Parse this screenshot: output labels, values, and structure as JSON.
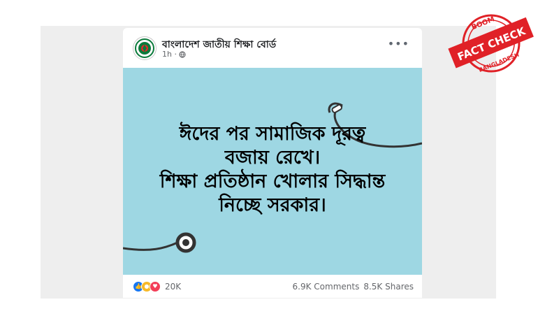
{
  "post": {
    "page_name": "বাংলাদেশ জাতীয় শিক্ষা বোর্ড",
    "time": "1h ·",
    "more_label": "•••",
    "image_text": [
      "ঈদের পর সামাজিক দূরত্ব",
      "বজায় রেখে।",
      "শিক্ষা প্রতিষ্ঠান খোলার সিদ্ধান্ত",
      "নিচ্ছে সরকার।"
    ],
    "reaction_count": "20K",
    "comments": "6.9K Comments",
    "shares": "8.5K Shares",
    "reactions": [
      "like-icon",
      "wow-icon",
      "love-icon"
    ]
  },
  "badge": {
    "top": "BOOM",
    "middle": "FACT CHECK",
    "bottom": "BANGLADESH",
    "color": "#e02127"
  },
  "colors": {
    "image_bg": "#9ed7e3",
    "frame_bg": "#eeeeee"
  }
}
